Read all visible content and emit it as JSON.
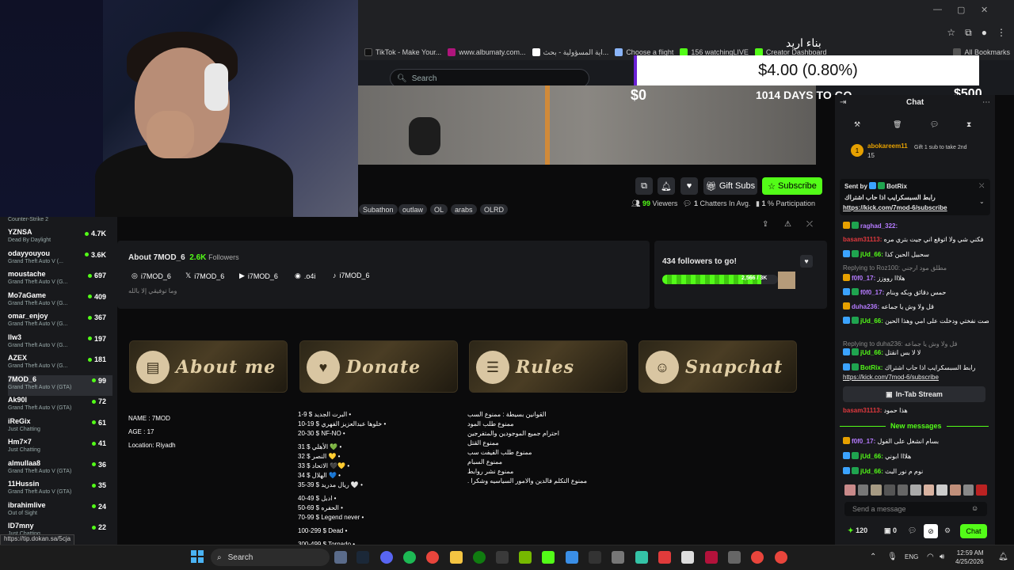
{
  "browser": {
    "bookmarks": [
      "TikTok - Make Your...",
      "www.albumaty.com...",
      "اية المسؤولية - بحث...",
      "Choose a flight",
      "156 watchingLIVE",
      "Creator Dashboard",
      "All Bookmarks"
    ],
    "win_controls": [
      "—",
      "▢",
      "✕"
    ]
  },
  "overlay": {
    "title_ar": "بناء اريد",
    "goal_amount": "$4.00 (0.80%)",
    "goal_start": "$0",
    "goal_end": "$500",
    "days_left": "1014 DAYS TO GO"
  },
  "header": {
    "search_placeholder": "Search"
  },
  "stream": {
    "actions": {
      "gift_subs": "Gift Subs",
      "subscribe": "Subscribe"
    },
    "tags": [
      "Subathon",
      "outlaw",
      "OL",
      "arabs",
      "OLRD"
    ],
    "viewers": "99",
    "viewers_label": "Viewers",
    "chatters": "1",
    "chatters_label": "Chatters In Avg.",
    "participation": "1",
    "participation_label": "% Participation"
  },
  "sidebar": {
    "top_game": "Counter-Strike 2",
    "items": [
      {
        "name": "YZNSA",
        "game": "Dead By Daylight",
        "count": "4.7K"
      },
      {
        "name": "odayyouyou",
        "game": "Grand Theft Auto V (...",
        "count": "3.6K"
      },
      {
        "name": "moustache",
        "game": "Grand Theft Auto V (G...",
        "count": "697"
      },
      {
        "name": "Mo7aGame",
        "game": "Grand Theft Auto V (G...",
        "count": "409"
      },
      {
        "name": "omar_enjoy",
        "game": "Grand Theft Auto V (G...",
        "count": "367"
      },
      {
        "name": "llw3",
        "game": "Grand Theft Auto V (G...",
        "count": "197"
      },
      {
        "name": "AZEX",
        "game": "Grand Theft Auto V (G...",
        "count": "181"
      },
      {
        "name": "7MOD_6",
        "game": "Grand Theft Auto V (GTA)",
        "count": "99"
      },
      {
        "name": "Ak90l",
        "game": "Grand Theft Auto V (GTA)",
        "count": "72"
      },
      {
        "name": "iReGix",
        "game": "Just Chatting",
        "count": "61"
      },
      {
        "name": "Hm7×7",
        "game": "Just Chatting",
        "count": "41"
      },
      {
        "name": "almullaa8",
        "game": "Grand Theft Auto V (GTA)",
        "count": "36"
      },
      {
        "name": "11Hussin",
        "game": "Grand Theft Auto V (GTA)",
        "count": "35"
      },
      {
        "name": "ibrahimlive",
        "game": "Out of Sight",
        "count": "24"
      },
      {
        "name": "ID7mny",
        "game": "Just Chatting",
        "count": "22"
      }
    ]
  },
  "about": {
    "title": "About 7MOD_6",
    "followers": "2.6K",
    "followers_label": "Followers",
    "socials": [
      "i7MOD_6",
      "i7MOD_6",
      "i7MOD_6",
      ".o4i",
      "i7MOD_6"
    ],
    "bio": "وما توفيقي إلا بالله"
  },
  "goal_card": {
    "title": "434 followers to go!",
    "progress_text": "2,566 / 3K",
    "progress": 0.855
  },
  "panels": [
    "About me",
    "Donate",
    "Rules",
    "Snapchat"
  ],
  "about_me": [
    "NAME : 7MOD",
    "AGE : 17",
    "Location: Riyadh"
  ],
  "donate": [
    "1-9 $ البرت الجديد •",
    "10-19 $ خلوها عبدالعزيز الفهري •",
    "20-30 $ NF-NO •",
    "31 $ الأهلي 💚 •",
    "32 $ النصر 💛 •",
    "33 $ الاتحاد 🖤💛 •",
    "34 $ الهلال 💙 •",
    "35-39 $ ريال مدريد 🤍 •",
    "40-49 $ ادبل •",
    "50-69 $ الحفره •",
    "70-99 $ Legend never •",
    "100-299 $ Dead •",
    "300-499 $ Tornado •"
  ],
  "rules": [
    "القوانين بسيطة : ممنوع السب",
    "ممنوع طلب المود",
    "احترام جميع الموجودين والمتفرجين",
    "ممنوع القتل",
    "ممنوع طلب الفيفت سب",
    "ممنوع السبام",
    "ممنوع نشر روابط",
    "ممنوع التكلم فالدين والامور السياسيه وشكرا ."
  ],
  "chat": {
    "title": "Chat",
    "top_gifter": "abokareem11",
    "top_gifter_count": "15",
    "gift_text": "Gift 1 sub to take 2nd",
    "pinned_sender": "Sent by",
    "pinned_bot": "BotRix",
    "pinned_text": "رابط السبسكرايب اذا حاب اشتراك",
    "pinned_link": "https://kick.com/7mod-6/subscribe",
    "messages": [
      {
        "user": "raghad_322:",
        "text": ""
      },
      {
        "user": "basam31113:",
        "text": "فكني شي ولا اتوقع اني جيت بتري مره"
      },
      {
        "user": "jUd_66:",
        "text": "سحبيل الحين كذا"
      },
      {
        "user": "Replying to Roz100:",
        "text": "مطلق مود ارجني"
      },
      {
        "user": "f0f0_17:",
        "text": "هلااا رووزز"
      },
      {
        "user": "f0f0_17:",
        "text": "حمس دقائق وبكه وبنام"
      },
      {
        "user": "duha236:",
        "text": "قل ولا وش يا جماعه"
      },
      {
        "user": "jUd_66:",
        "text": "خلصت نفختي ودخلت على امي وهذا الحين"
      },
      {
        "user": "Replying to duha236:",
        "text": "قل ولا وش يا جماعه"
      },
      {
        "user": "jUd_66:",
        "text": "لا لا بس انقتل"
      },
      {
        "user": "BotRix:",
        "text": "رابط السبسكرايب اذا حاب اشتراك"
      },
      {
        "user": "basam31113:",
        "text": "هذا حمود"
      },
      {
        "user": "f0f0_17:",
        "text": "بسام انشغل على الفول"
      },
      {
        "user": "jUd_66:",
        "text": "هلااا ابوني"
      },
      {
        "user": "jUd_66:",
        "text": "نوم م نور البث"
      }
    ],
    "link_msg": "https://kick.com/7mod-6/subscribe",
    "in_tab": "In-Tab Stream",
    "new_messages": "New messages",
    "input_placeholder": "Send a message",
    "points": "120",
    "zero": "0",
    "send_label": "Chat"
  },
  "taskbar": {
    "search": "Search",
    "lang": "ENG",
    "time": "12:59 AM",
    "date": "4/25/2026"
  },
  "status_url": "https://tip.dokan.sa/5cja",
  "colors": {
    "accent": "#53fc18",
    "bg": "#0b0b0c",
    "panel": "#18191c"
  }
}
